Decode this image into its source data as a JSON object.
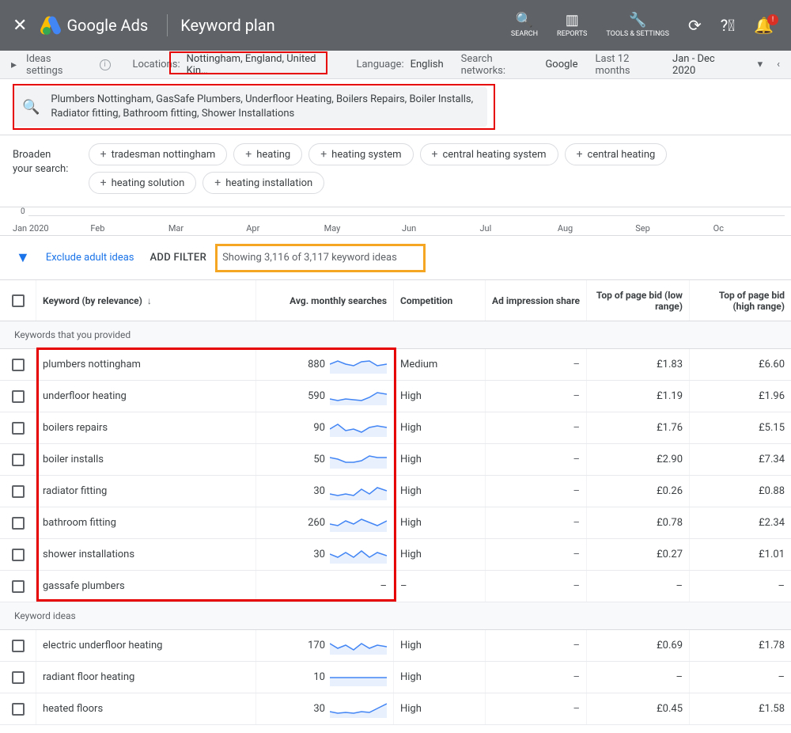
{
  "header": {
    "product": "Google Ads",
    "page_title": "Keyword plan",
    "nav": {
      "search": "SEARCH",
      "reports": "REPORTS",
      "tools": "TOOLS & SETTINGS"
    },
    "notification_count": "!"
  },
  "settings": {
    "ideas_label": "Ideas settings",
    "locations_label": "Locations:",
    "locations_value": "Nottingham, England, United Kin…",
    "language_label": "Language:",
    "language_value": "English",
    "networks_label": "Search networks:",
    "networks_value": "Google",
    "daterange_label": "Last 12 months",
    "daterange_value": "Jan - Dec 2020"
  },
  "search": {
    "keywords": "Plumbers Nottingham, GasSafe Plumbers, Underfloor Heating, Boilers Repairs, Boiler Installs, Radiator fitting, Bathroom fitting, Shower Installations"
  },
  "broaden": {
    "label": "Broaden your search:",
    "chips": [
      "tradesman nottingham",
      "heating",
      "heating system",
      "central heating system",
      "central heating",
      "heating solution",
      "heating installation"
    ]
  },
  "timeline": {
    "zero": "0",
    "months": [
      "Jan 2020",
      "Feb",
      "Mar",
      "Apr",
      "May",
      "Jun",
      "Jul",
      "Aug",
      "Sep",
      "Oc"
    ]
  },
  "filters": {
    "exclude": "Exclude adult ideas",
    "add_filter": "ADD FILTER",
    "showing": "Showing 3,116 of 3,117 keyword ideas"
  },
  "columns": {
    "keyword": "Keyword (by relevance)",
    "avg": "Avg. monthly searches",
    "competition": "Competition",
    "impression": "Ad impression share",
    "low": "Top of page bid (low range)",
    "high": "Top of page bid (high range)"
  },
  "sections": {
    "provided": "Keywords that you provided",
    "ideas": "Keyword ideas"
  },
  "rows_provided": [
    {
      "kw": "plumbers nottingham",
      "avg": "880",
      "comp": "Medium",
      "imp": "–",
      "low": "£1.83",
      "high": "£6.60"
    },
    {
      "kw": "underfloor heating",
      "avg": "590",
      "comp": "High",
      "imp": "–",
      "low": "£1.19",
      "high": "£1.96"
    },
    {
      "kw": "boilers repairs",
      "avg": "90",
      "comp": "High",
      "imp": "–",
      "low": "£1.76",
      "high": "£5.15"
    },
    {
      "kw": "boiler installs",
      "avg": "50",
      "comp": "High",
      "imp": "–",
      "low": "£2.90",
      "high": "£7.34"
    },
    {
      "kw": "radiator fitting",
      "avg": "30",
      "comp": "High",
      "imp": "–",
      "low": "£0.26",
      "high": "£0.88"
    },
    {
      "kw": "bathroom fitting",
      "avg": "260",
      "comp": "High",
      "imp": "–",
      "low": "£0.78",
      "high": "£2.34"
    },
    {
      "kw": "shower installations",
      "avg": "30",
      "comp": "High",
      "imp": "–",
      "low": "£0.27",
      "high": "£1.01"
    },
    {
      "kw": "gassafe plumbers",
      "avg": "–",
      "comp": "–",
      "imp": "–",
      "low": "–",
      "high": "–"
    }
  ],
  "rows_ideas": [
    {
      "kw": "electric underfloor heating",
      "avg": "170",
      "comp": "High",
      "imp": "–",
      "low": "£0.69",
      "high": "£1.78"
    },
    {
      "kw": "radiant floor heating",
      "avg": "10",
      "comp": "High",
      "imp": "–",
      "low": "–",
      "high": "–"
    },
    {
      "kw": "heated floors",
      "avg": "30",
      "comp": "High",
      "imp": "–",
      "low": "£0.45",
      "high": "£1.58"
    }
  ]
}
